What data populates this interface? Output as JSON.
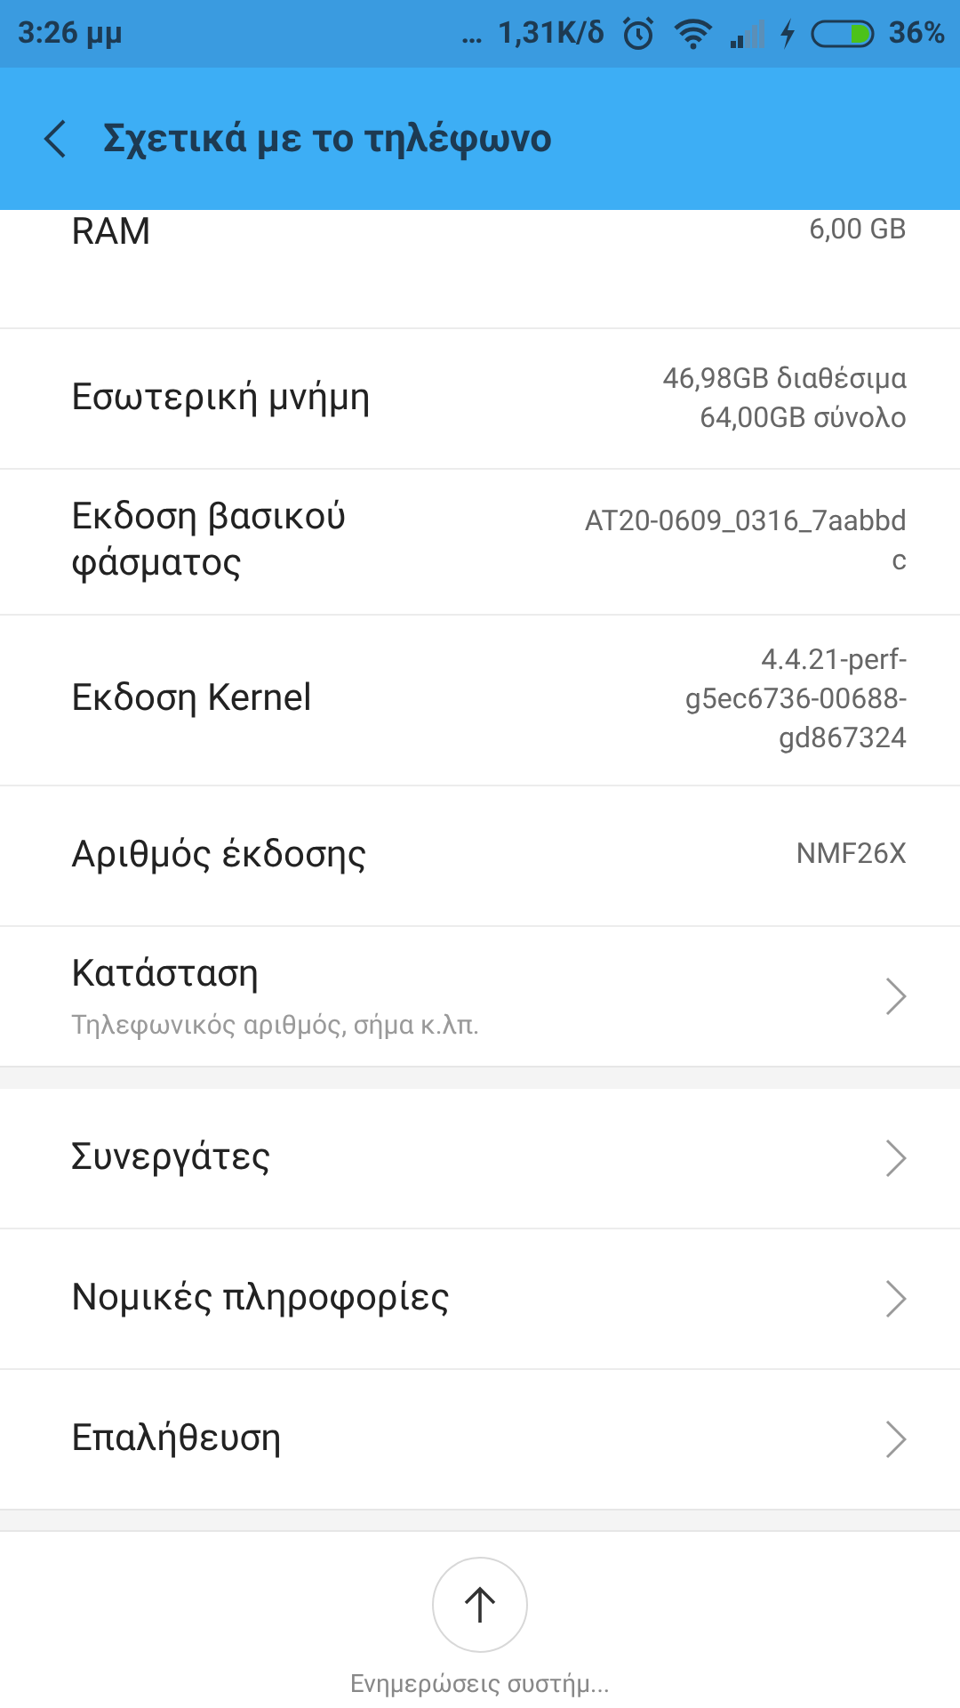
{
  "status_bar": {
    "time": "3:26 μμ",
    "more": "…",
    "speed": "1,31K/δ",
    "battery": "36%"
  },
  "header": {
    "title": "Σχετικά με το τηλέφωνο"
  },
  "sections": [
    {
      "items": [
        {
          "kind": "value",
          "label": "RAM",
          "value_lines": [
            "6,00 GB"
          ]
        },
        {
          "kind": "value",
          "label": "Εσωτερική μνήμη",
          "value_lines": [
            "46,98GB διαθέσιμα",
            "64,00GB σύνολο"
          ]
        },
        {
          "kind": "value",
          "label": "Εκδοση βασικού φάσματος",
          "value_lines": [
            "AT20-0609_0316_7aabbd",
            "c"
          ]
        },
        {
          "kind": "value",
          "label": "Εκδοση Kernel",
          "value_lines": [
            "4.4.21-perf-",
            "g5ec6736-00688-",
            "gd867324"
          ]
        },
        {
          "kind": "value",
          "label": "Αριθμός έκδοσης",
          "value_lines": [
            "NMF26X"
          ]
        },
        {
          "kind": "link",
          "label": "Κατάσταση",
          "subtitle": "Τηλεφωνικός αριθμός, σήμα κ.λπ."
        }
      ]
    },
    {
      "items": [
        {
          "kind": "link",
          "label": "Συνεργάτες"
        },
        {
          "kind": "link",
          "label": "Νομικές πληροφορίες"
        },
        {
          "kind": "link",
          "label": "Επαλήθευση"
        }
      ]
    }
  ],
  "bottom_action": {
    "label": "Ενημερώσεις συστήμ..."
  }
}
